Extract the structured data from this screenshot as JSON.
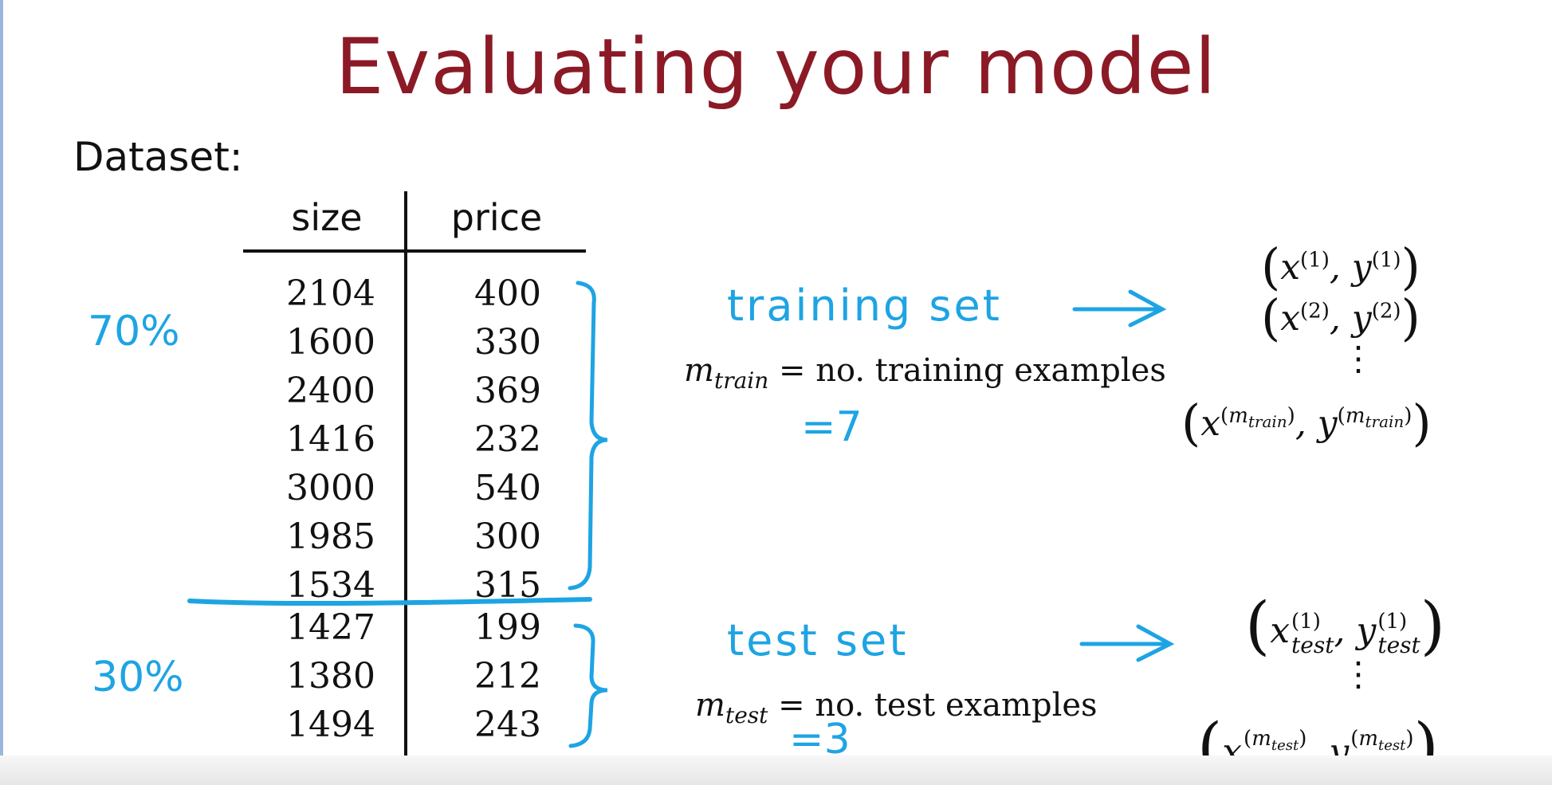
{
  "title": "Evaluating your model",
  "dataset_label": "Dataset:",
  "table": {
    "headers": [
      "size",
      "price"
    ],
    "train_rows": [
      [
        "2104",
        "400"
      ],
      [
        "1600",
        "330"
      ],
      [
        "2400",
        "369"
      ],
      [
        "1416",
        "232"
      ],
      [
        "3000",
        "540"
      ],
      [
        "1985",
        "300"
      ],
      [
        "1534",
        "315"
      ]
    ],
    "test_rows": [
      [
        "1427",
        "199"
      ],
      [
        "1380",
        "212"
      ],
      [
        "1494",
        "243"
      ]
    ]
  },
  "split": {
    "train_percent": "70%",
    "test_percent": "30%"
  },
  "training": {
    "label": "training set",
    "m_symbol": "m",
    "m_subscript": "train",
    "definition": "= no. training examples",
    "count": "=7",
    "tuples": {
      "x": "x",
      "y": "y",
      "sup1": "(1)",
      "sup2": "(2)",
      "sup_last_base": "m",
      "sup_last_sub": "train"
    }
  },
  "test": {
    "label": "test set",
    "m_symbol": "m",
    "m_subscript": "test",
    "definition": "= no. test examples",
    "count": "=3",
    "tuples": {
      "x": "x",
      "y": "y",
      "subscript": "test",
      "sup1": "(1)",
      "sup_last_base": "m",
      "sup_last_sub": "test"
    }
  },
  "colors": {
    "title": "#8b1a26",
    "annotation": "#1ea4e3",
    "text": "#111111"
  }
}
